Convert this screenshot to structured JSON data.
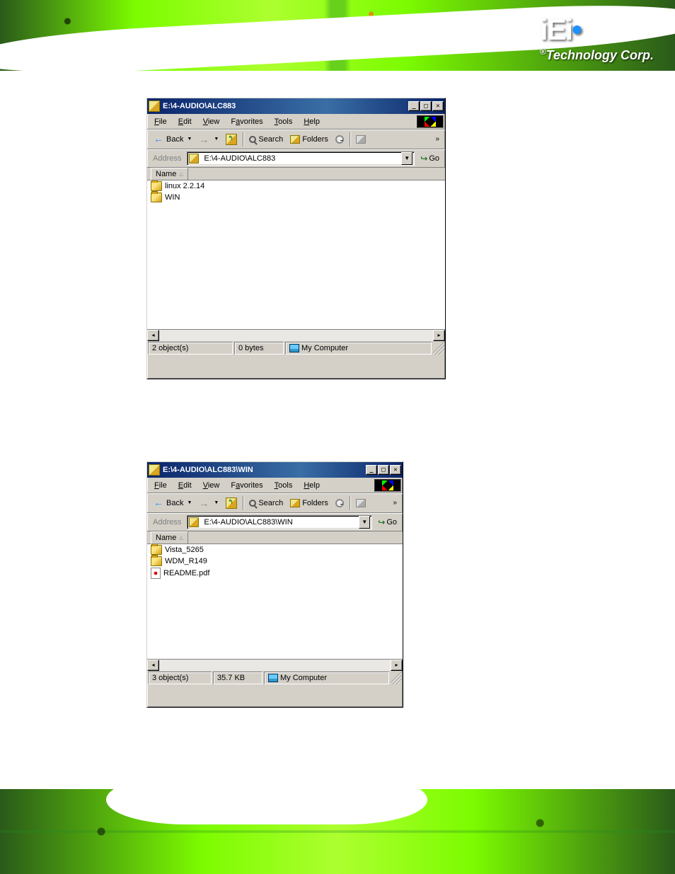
{
  "logo": {
    "main": "iEi",
    "sub": "Technology Corp.",
    "reg": "®"
  },
  "menu": {
    "file": "File",
    "edit": "Edit",
    "view": "View",
    "favorites": "Favorites",
    "tools": "Tools",
    "help": "Help"
  },
  "toolbar": {
    "back": "Back",
    "search": "Search",
    "folders": "Folders",
    "go": "Go"
  },
  "address_label": "Address",
  "column_name": "Name",
  "status_zone": "My Computer",
  "window1": {
    "title": "E:\\4-AUDIO\\ALC883",
    "address": "E:\\4-AUDIO\\ALC883",
    "items": [
      {
        "type": "folder",
        "name": "linux 2.2.14"
      },
      {
        "type": "folder",
        "name": "WIN"
      }
    ],
    "status_objects": "2 object(s)",
    "status_size": "0 bytes"
  },
  "window2": {
    "title": "E:\\4-AUDIO\\ALC883\\WIN",
    "address": "E:\\4-AUDIO\\ALC883\\WIN",
    "items": [
      {
        "type": "folder",
        "name": "Vista_5265"
      },
      {
        "type": "folder",
        "name": "WDM_R149"
      },
      {
        "type": "pdf",
        "name": "README.pdf"
      }
    ],
    "status_objects": "3 object(s)",
    "status_size": "35.7 KB"
  }
}
